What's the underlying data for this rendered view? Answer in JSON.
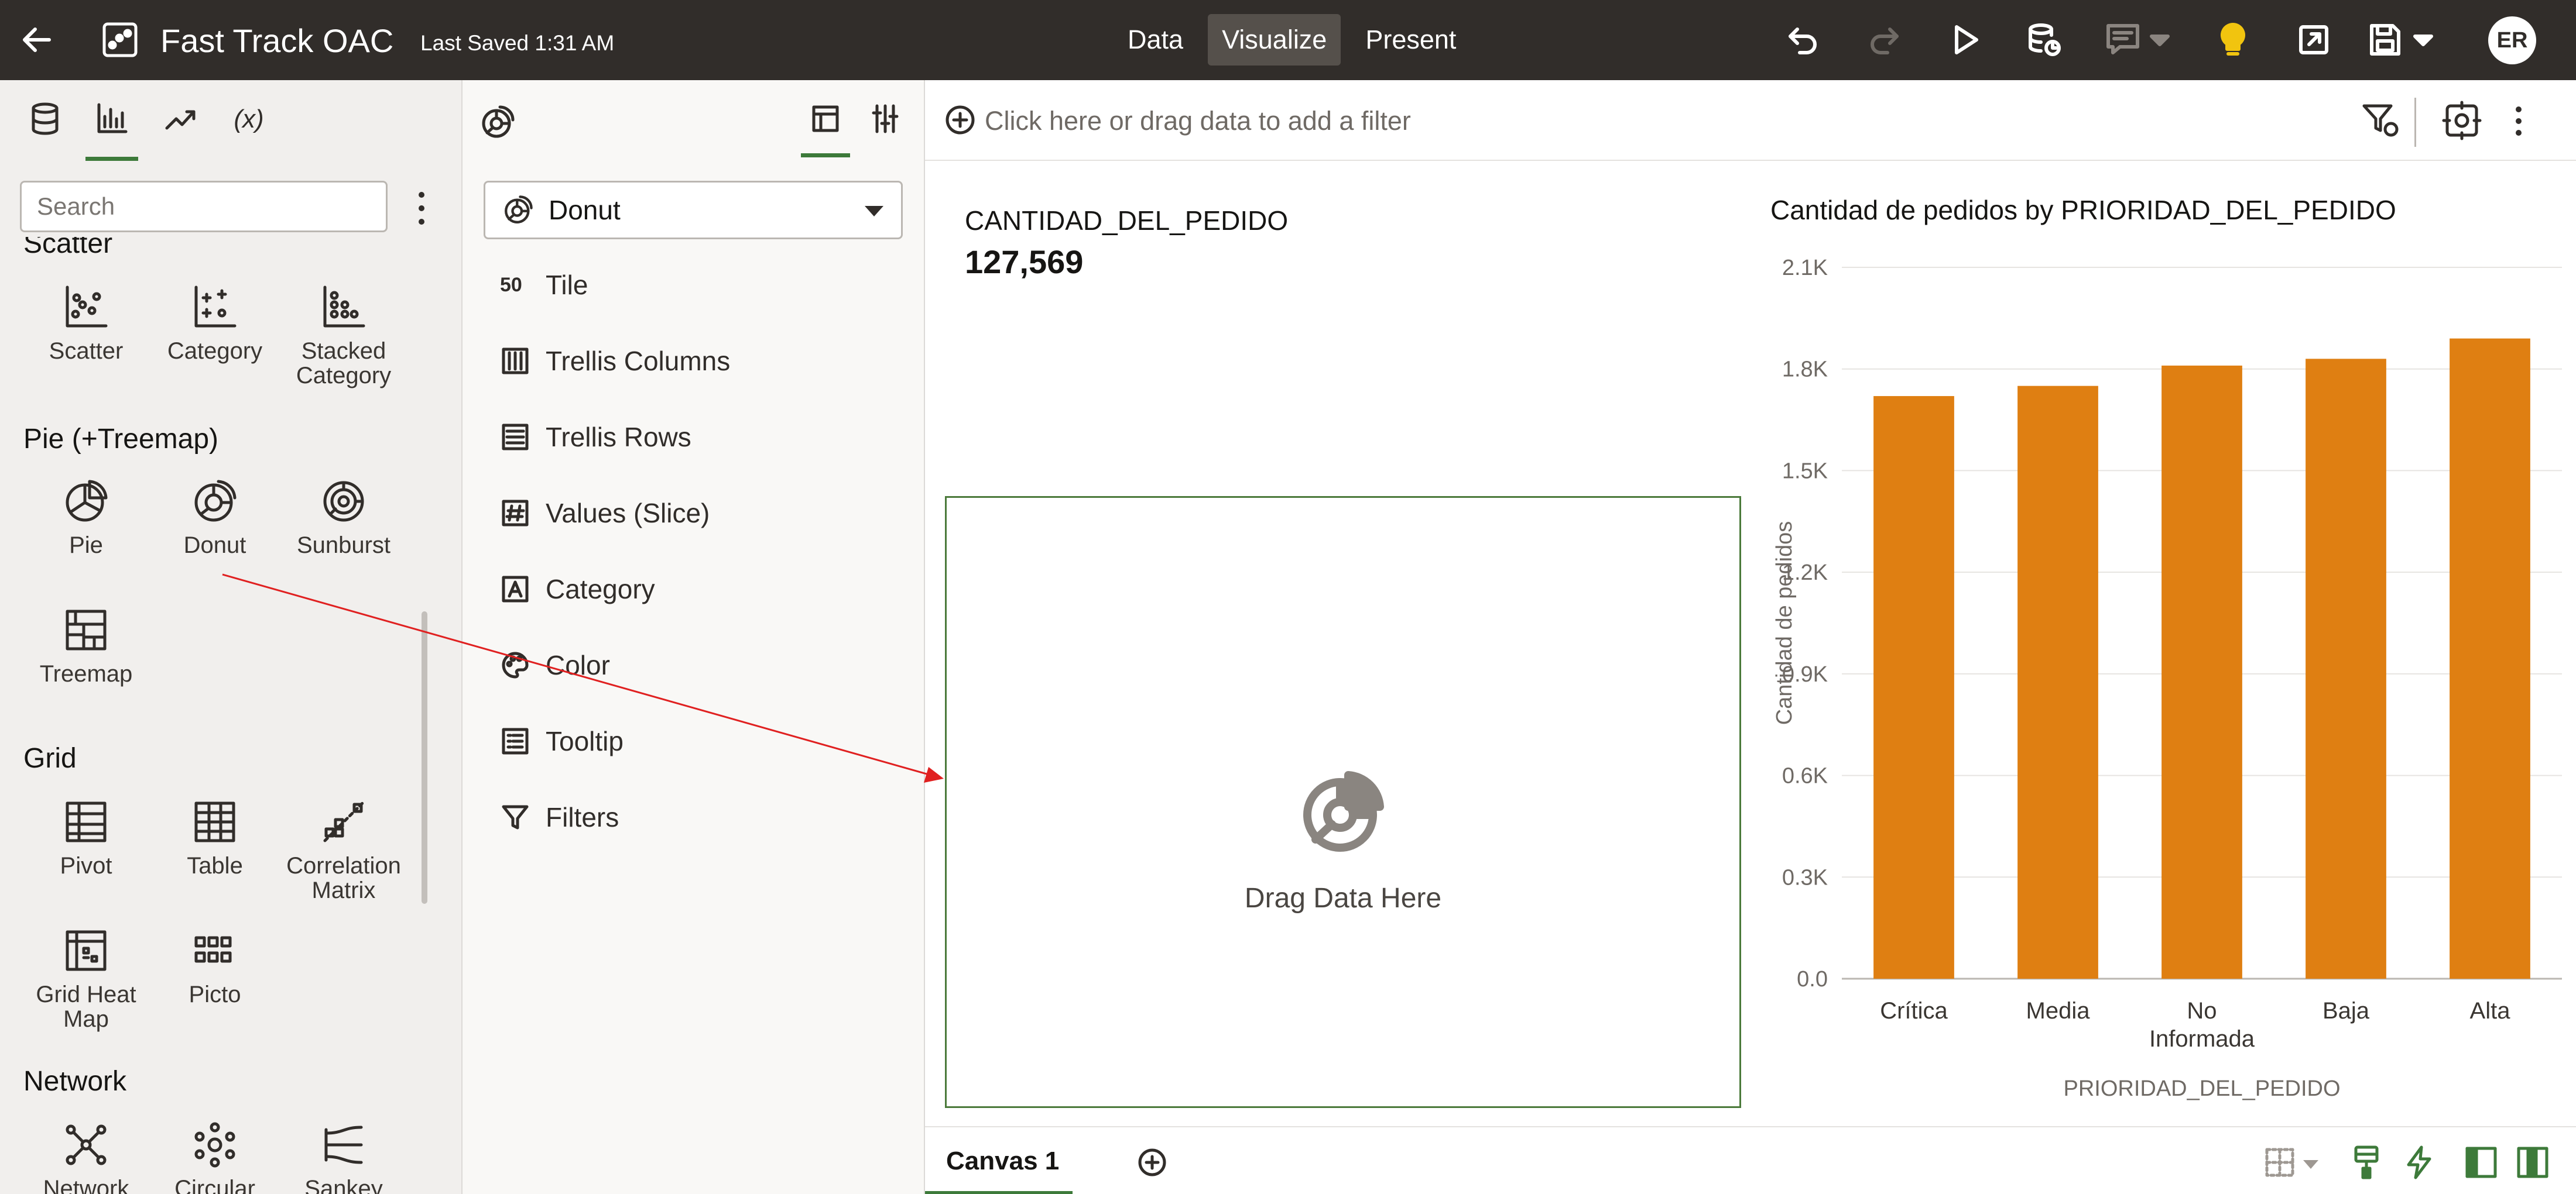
{
  "header": {
    "title": "Fast Track OAC",
    "last_saved": "Last Saved 1:31 AM",
    "modes": [
      {
        "label": "Data",
        "active": false
      },
      {
        "label": "Visualize",
        "active": true
      },
      {
        "label": "Present",
        "active": false
      }
    ],
    "user_initials": "ER"
  },
  "left_panel": {
    "tabs": [
      {
        "icon": "database-icon"
      },
      {
        "icon": "bar-chart-icon",
        "active": true
      },
      {
        "icon": "trend-icon"
      },
      {
        "label": "(x)",
        "icon": "calculation-icon"
      }
    ],
    "search_placeholder": "Search",
    "groups": {
      "scatter": {
        "title": "Scatter",
        "items": [
          "Scatter",
          "Category",
          "Stacked Category"
        ]
      },
      "pie": {
        "title": "Pie (+Treemap)",
        "items": [
          "Pie",
          "Donut",
          "Sunburst",
          "Treemap"
        ]
      },
      "grid": {
        "title": "Grid",
        "items": [
          "Pivot",
          "Table",
          "Correlation Matrix",
          "Grid Heat Map",
          "Picto"
        ]
      },
      "network": {
        "title": "Network",
        "items": [
          "Network",
          "Circular",
          "Sankey"
        ]
      }
    }
  },
  "grammar": {
    "viz_type": "Donut",
    "tile_number": "50",
    "sections": [
      "Tile",
      "Trellis Columns",
      "Trellis Rows",
      "Values (Slice)",
      "Category",
      "Color",
      "Tooltip",
      "Filters"
    ]
  },
  "filter_bar": {
    "placeholder": "Click here or drag data to add a filter"
  },
  "canvas": {
    "tile": {
      "title": "CANTIDAD_DEL_PEDIDO",
      "value": "127,569"
    },
    "drop_zone_text": "Drag Data Here",
    "tab_label": "Canvas 1"
  },
  "chart_data": {
    "type": "bar",
    "title": "Cantidad de pedidos by PRIORIDAD_DEL_PEDIDO",
    "xlabel": "PRIORIDAD_DEL_PEDIDO",
    "ylabel": "Cantidad de pedidos",
    "categories": [
      "Crítica",
      "Media",
      "No Informada",
      "Baja",
      "Alta"
    ],
    "values": [
      1720,
      1750,
      1810,
      1830,
      1890
    ],
    "ylim": [
      0,
      2100
    ],
    "yticks": [
      0,
      300,
      600,
      900,
      1200,
      1500,
      1800,
      2100
    ],
    "ytick_labels": [
      "0.0",
      "0.3K",
      "0.6K",
      "0.9K",
      "1.2K",
      "1.5K",
      "1.8K",
      "2.1K"
    ],
    "bar_color": "#df7f12",
    "grid": true
  }
}
